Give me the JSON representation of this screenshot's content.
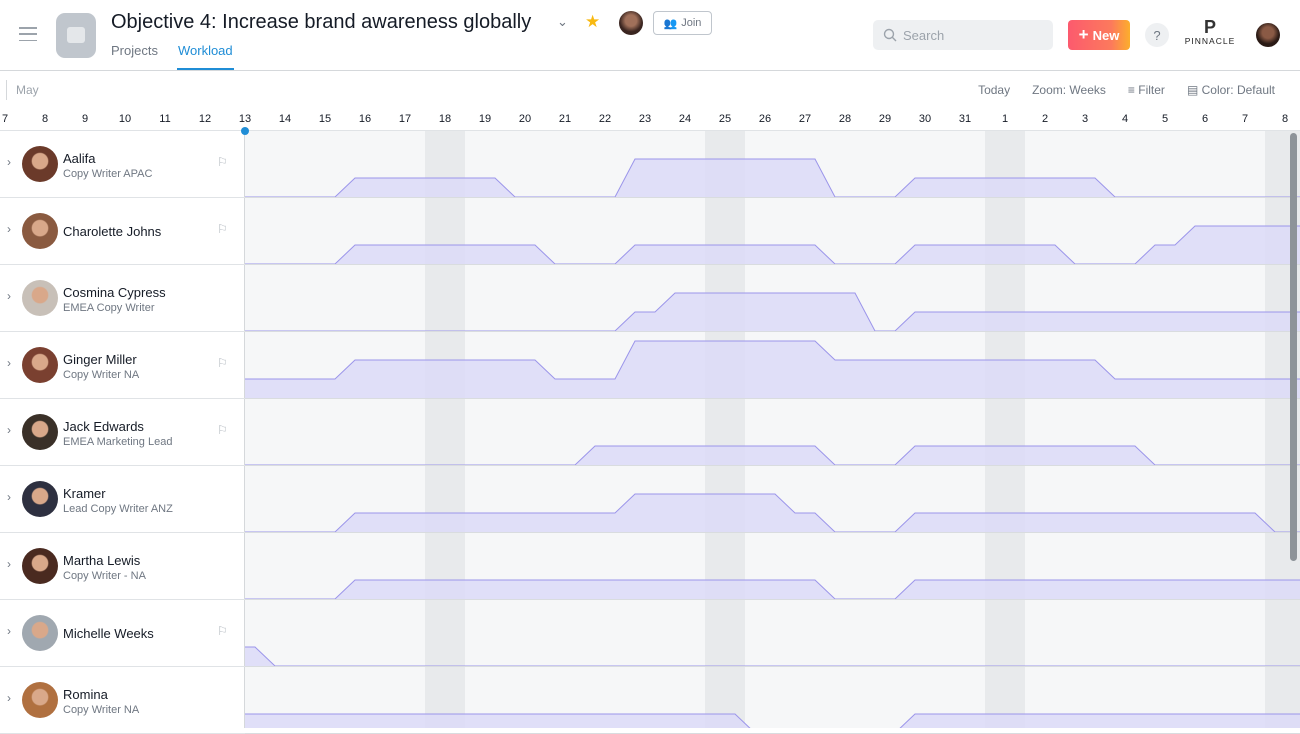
{
  "header": {
    "title": "Objective 4: Increase brand awareness globally",
    "join_label": "Join",
    "tabs": [
      {
        "label": "Projects",
        "active": false
      },
      {
        "label": "Workload",
        "active": true
      }
    ],
    "search_placeholder": "Search",
    "new_label": "New",
    "help_label": "?",
    "brand": "PINNACLE",
    "brand_mark": "P"
  },
  "toolbar": {
    "month": "May",
    "today": "Today",
    "zoom": "Zoom: Weeks",
    "filter": "Filter",
    "color": "Color: Default"
  },
  "colors": {
    "accent": "#1f8dd6",
    "load_fill": "#dcdaf8",
    "load_stroke": "#9b95ea",
    "new_button": "#fc6470"
  },
  "days": [
    "7",
    "8",
    "9",
    "10",
    "11",
    "12",
    "13",
    "14",
    "15",
    "16",
    "17",
    "18",
    "19",
    "20",
    "21",
    "22",
    "23",
    "24",
    "25",
    "26",
    "27",
    "28",
    "29",
    "30",
    "31",
    "1",
    "2",
    "3",
    "4",
    "5",
    "6",
    "7",
    "8"
  ],
  "today": "May 13",
  "weekends": [
    [
      "May 18",
      "May 19"
    ],
    [
      "May 25",
      "May 26"
    ],
    [
      "Jun 1",
      "Jun 2"
    ],
    [
      "Jun 8",
      "Jun 9"
    ]
  ],
  "people": [
    {
      "name": "Aalifa",
      "role": "Copy Writer APAC",
      "flag": true,
      "workload": [
        {
          "from": "May 15",
          "to": "May 19",
          "load": 1
        },
        {
          "from": "May 22",
          "to": "May 27",
          "load": 2
        },
        {
          "from": "May 29",
          "to": "Jun 3",
          "load": 1
        }
      ]
    },
    {
      "name": "Charolette Johns",
      "role": "",
      "flag": true,
      "workload": [
        {
          "from": "May 15",
          "to": "May 20",
          "load": 1
        },
        {
          "from": "May 22",
          "to": "May 27",
          "load": 1
        },
        {
          "from": "May 29",
          "to": "Jun 2",
          "load": 1
        },
        {
          "from": "Jun 4",
          "to": "Jun 10",
          "load": 1
        },
        {
          "from": "Jun 5",
          "to": "Jun 10",
          "load": 1
        }
      ]
    },
    {
      "name": "Cosmina Cypress",
      "role": "EMEA Copy Writer",
      "flag": false,
      "workload": [
        {
          "from": "May 22",
          "to": "May 28",
          "load": 1
        },
        {
          "from": "May 23",
          "to": "May 28",
          "load": 1
        },
        {
          "from": "May 29",
          "to": "Jun 10",
          "load": 1
        }
      ]
    },
    {
      "name": "Ginger Miller",
      "role": "Copy Writer NA",
      "flag": true,
      "workload": [
        {
          "from": "May 1",
          "to": "Jun 10",
          "load": 1
        },
        {
          "from": "May 15",
          "to": "May 20",
          "load": 1
        },
        {
          "from": "May 22",
          "to": "Jun 3",
          "load": 1
        },
        {
          "from": "May 22",
          "to": "May 27",
          "load": 1
        }
      ]
    },
    {
      "name": "Jack Edwards",
      "role": "EMEA Marketing Lead",
      "flag": true,
      "workload": [
        {
          "from": "May 21",
          "to": "May 27",
          "load": 1
        },
        {
          "from": "May 29",
          "to": "Jun 4",
          "load": 1
        }
      ]
    },
    {
      "name": "Kramer",
      "role": "Lead Copy Writer ANZ",
      "flag": false,
      "workload": [
        {
          "from": "May 15",
          "to": "May 27",
          "load": 1
        },
        {
          "from": "May 22",
          "to": "May 26",
          "load": 1
        },
        {
          "from": "May 29",
          "to": "Jun 7",
          "load": 1
        }
      ]
    },
    {
      "name": "Martha Lewis",
      "role": "Copy Writer - NA",
      "flag": false,
      "workload": [
        {
          "from": "May 15",
          "to": "May 27",
          "load": 1
        },
        {
          "from": "May 29",
          "to": "Jun 10",
          "load": 1
        }
      ]
    },
    {
      "name": "Michelle Weeks",
      "role": "",
      "flag": true,
      "workload": [
        {
          "from": "May 1",
          "to": "May 13",
          "load": 1
        }
      ]
    },
    {
      "name": "Romina",
      "role": "Copy Writer NA",
      "flag": false,
      "workload": [
        {
          "from": "May 1",
          "to": "May 25",
          "load": 1
        },
        {
          "from": "May 29",
          "to": "Jun 10",
          "load": 1
        }
      ]
    }
  ]
}
